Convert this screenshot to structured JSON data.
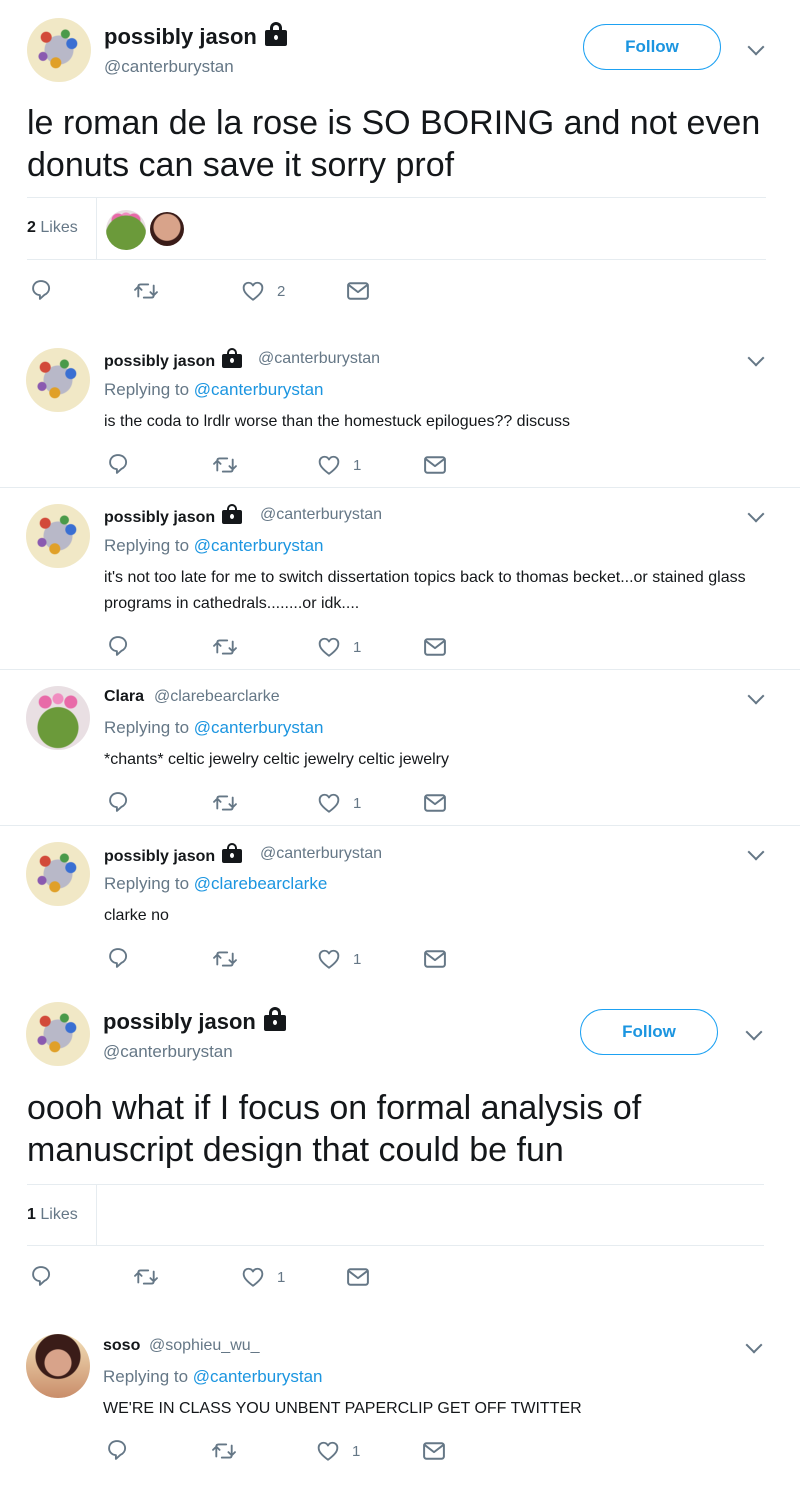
{
  "tweet1": {
    "name": "possibly jason",
    "handle": "@canterburystan",
    "follow_label": "Follow",
    "text": "le roman de la rose is SO BORING and not even donuts can save it sorry prof",
    "likes_count": "2",
    "likes_label": "Likes",
    "like_action_count": "2"
  },
  "reply1": {
    "name": "possibly jason",
    "handle": "@canterburystan",
    "replying_prefix": "Replying to",
    "replying_to": "@canterburystan",
    "text": "is the coda to lrdlr worse than the homestuck epilogues?? discuss",
    "like_count": "1"
  },
  "reply2": {
    "name": "possibly jason",
    "handle": "@canterburystan",
    "replying_prefix": "Replying to",
    "replying_to": "@canterburystan",
    "text": "it's not too late for me to switch dissertation topics back to thomas becket...or stained glass programs in cathedrals........or idk....",
    "like_count": "1"
  },
  "reply3": {
    "name": "Clara",
    "handle": "@clarebearclarke",
    "replying_prefix": "Replying to",
    "replying_to": "@canterburystan",
    "text": "*chants* celtic jewelry celtic jewelry celtic jewelry",
    "like_count": "1"
  },
  "reply4": {
    "name": "possibly jason",
    "handle": "@canterburystan",
    "replying_prefix": "Replying to",
    "replying_to": "@clarebearclarke",
    "text": "clarke no",
    "like_count": "1"
  },
  "tweet2": {
    "name": "possibly jason",
    "handle": "@canterburystan",
    "follow_label": "Follow",
    "text": "oooh what if I focus on formal analysis of manuscript design that could be fun",
    "likes_count": "1",
    "likes_label": "Likes",
    "like_action_count": "1"
  },
  "reply5": {
    "name": "soso",
    "handle": "@sophieu_wu_",
    "replying_prefix": "Replying to",
    "replying_to": "@canterburystan",
    "text": "WE'RE IN CLASS YOU UNBENT PAPERCLIP GET OFF TWITTER",
    "like_count": "1"
  },
  "colors": {
    "link": "#1b95e0",
    "muted": "#657786",
    "border": "#e6ecf0"
  },
  "icons": [
    "lock-icon",
    "chevron-down-icon",
    "reply-icon",
    "retweet-icon",
    "heart-icon",
    "mail-icon"
  ]
}
